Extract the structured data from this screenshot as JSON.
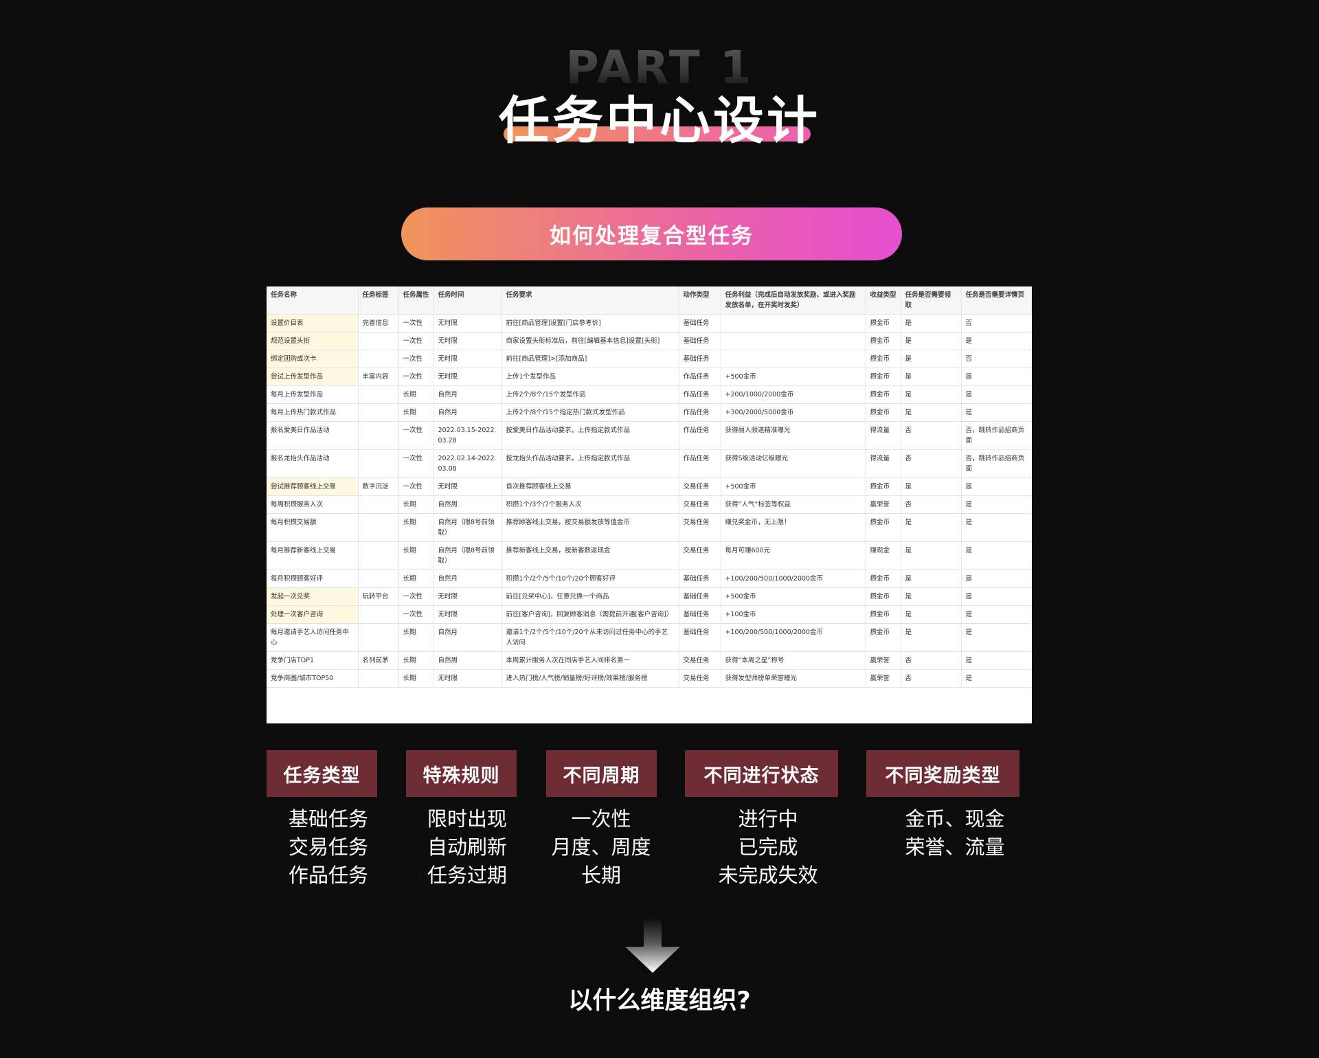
{
  "header": {
    "part_label": "PART 1",
    "title": "任务中心设计"
  },
  "pill": {
    "label": "如何处理复合型任务"
  },
  "table": {
    "columns": [
      "任务名称",
      "任务标签",
      "任务属性",
      "任务时间",
      "任务要求",
      "动作类型",
      "任务利益（完成后自动发放奖励、或进入奖励发放名单，在开奖时发奖）",
      "收益类型",
      "任务是否需要领取",
      "任务是否需要详情页"
    ],
    "rows": [
      [
        "设置价目表",
        "完善信息",
        "一次性",
        "无时限",
        "前往[商品管理]设置[门店参考价]",
        "基础任务",
        "",
        "攒金币",
        "是",
        "否"
      ],
      [
        "规范设置头衔",
        "",
        "一次性",
        "无时限",
        "商家设置头衔标准后，前往[编辑基本信息]设置[头衔]",
        "基础任务",
        "",
        "攒金币",
        "是",
        "是"
      ],
      [
        "绑定团购或次卡",
        "",
        "一次性",
        "无时限",
        "前往[商品管理]>[添加商品]",
        "基础任务",
        "",
        "攒金币",
        "是",
        "否"
      ],
      [
        "尝试上传发型作品",
        "丰富内容",
        "一次性",
        "无时限",
        "上传1个发型作品",
        "作品任务",
        "+500金币",
        "攒金币",
        "是",
        "是"
      ],
      [
        "每月上传发型作品",
        "",
        "长期",
        "自然月",
        "上传2个/8个/15个发型作品",
        "作品任务",
        "+200/1000/2000金币",
        "攒金币",
        "是",
        "是"
      ],
      [
        "每月上传热门款式作品",
        "",
        "长期",
        "自然月",
        "上传2个/8个/15个指定热门款式发型作品",
        "作品任务",
        "+300/2000/5000金币",
        "攒金币",
        "是",
        "是"
      ],
      [
        "报名爱美日作品活动",
        "",
        "一次性",
        "2022.03.15-2022.03.28",
        "按爱美日作品活动要求，上传指定款式作品",
        "作品任务",
        "获得丽人频道精准曝光",
        "得流量",
        "否",
        "否，跳转作品招商页面"
      ],
      [
        "报名龙抬头作品活动",
        "",
        "一次性",
        "2022.02.14-2022.03.08",
        "按龙抬头作品活动要求，上传指定款式作品",
        "作品任务",
        "获得S级活动亿级曝光",
        "得流量",
        "否",
        "否，跳转作品招商页面"
      ],
      [
        "尝试推荐顾客线上交易",
        "数字沉淀",
        "一次性",
        "无时限",
        "首次推荐顾客线上交易",
        "交易任务",
        "+500金币",
        "攒金币",
        "是",
        "是"
      ],
      [
        "每周积攒服务人次",
        "",
        "长期",
        "自然周",
        "积攒1个/3个/7个服务人次",
        "交易任务",
        "获得“人气”标签等权益",
        "赢荣誉",
        "否",
        "是"
      ],
      [
        "每月积攒交易额",
        "",
        "长期",
        "自然月（限8号前领取）",
        "推荐顾客线上交易，按交易额发放等值金币",
        "交易任务",
        "赚兑奖金币，无上限！",
        "攒金币",
        "是",
        "是"
      ],
      [
        "每月推荐新客线上交易",
        "",
        "长期",
        "自然月（限8号前领取）",
        "推荐新客线上交易，按新客数返现金",
        "交易任务",
        "每月可赚600元",
        "赚现金",
        "是",
        "是"
      ],
      [
        "每月积攒顾客好评",
        "",
        "长期",
        "自然月",
        "积攒1个/2个/5个/10个/20个顾客好评",
        "基础任务",
        "+100/200/500/1000/2000金币",
        "攒金币",
        "是",
        "是"
      ],
      [
        "发起一次兑奖",
        "玩转平台",
        "一次性",
        "无时限",
        "前往[兑奖中心]，任意兑换一个商品",
        "基础任务",
        "+500金币",
        "攒金币",
        "是",
        "是"
      ],
      [
        "处理一次客户咨询",
        "",
        "一次性",
        "无时限",
        "前往[客户咨询]，回复顾客消息（需提前开通[客户咨询]）",
        "基础任务",
        "+100金币",
        "攒金币",
        "是",
        "是"
      ],
      [
        "每月邀请手艺人访问任务中心",
        "",
        "长期",
        "自然月",
        "邀请1个/2个/5个/10个/20个从未访问过任务中心的手艺人访问",
        "基础任务",
        "+100/200/500/1000/2000金币",
        "攒金币",
        "是",
        "是"
      ],
      [
        "竞争门店TOP1",
        "名列前茅",
        "长期",
        "自然周",
        "本周累计服务人次在同店手艺人间排名第一",
        "交易任务",
        "获得“本周之星”称号",
        "赢荣誉",
        "否",
        "是"
      ],
      [
        "竞争商圈/城市TOP50",
        "",
        "长期",
        "无时限",
        "进入热门榜/人气榜/销量榜/好评榜/效果榜/服务榜",
        "交易任务",
        "获得发型师榜单荣誉曝光",
        "赢荣誉",
        "否",
        "是"
      ]
    ]
  },
  "categories": [
    {
      "title": "任务类型",
      "items": [
        "基础任务",
        "交易任务",
        "作品任务"
      ]
    },
    {
      "title": "特殊规则",
      "items": [
        "限时出现",
        "自动刷新",
        "任务过期"
      ]
    },
    {
      "title": "不同周期",
      "items": [
        "一次性",
        "月度、周度",
        "长期"
      ]
    },
    {
      "title": "不同进行状态",
      "items": [
        "进行中",
        "已完成",
        "未完成失效"
      ]
    },
    {
      "title": "不同奖励类型",
      "items": [
        "金币、现金",
        "荣誉、流量"
      ]
    }
  ],
  "footer": {
    "question": "以什么维度组织?"
  },
  "colors": {
    "background": "#0d0c0d",
    "gradient_start": "#f0955a",
    "gradient_end": "#e54fd0",
    "category_block": "#6e2d34",
    "highlight_cell": "#fdf9e0"
  }
}
